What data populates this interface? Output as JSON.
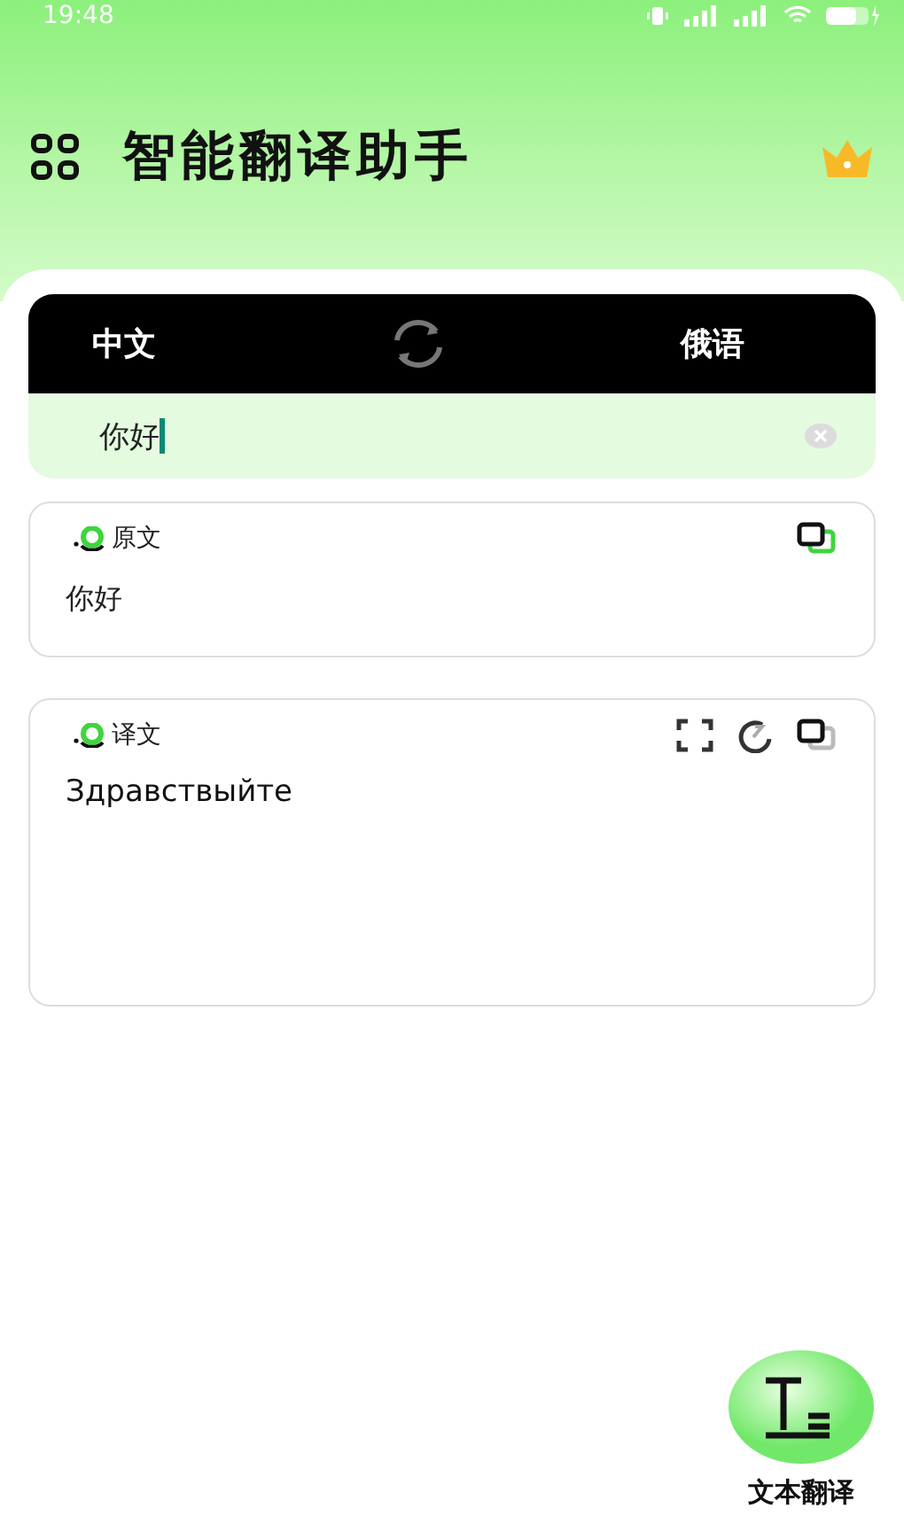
{
  "status_bar": {
    "time": "19:48"
  },
  "header": {
    "title": "智能翻译助手"
  },
  "languages": {
    "source": "中文",
    "target": "俄语"
  },
  "input": {
    "value": "你好"
  },
  "source_card": {
    "label": "原文",
    "text": "你好"
  },
  "result_card": {
    "label": "译文",
    "text": "Здравствыйте"
  },
  "fab": {
    "label": "文本翻译"
  }
}
